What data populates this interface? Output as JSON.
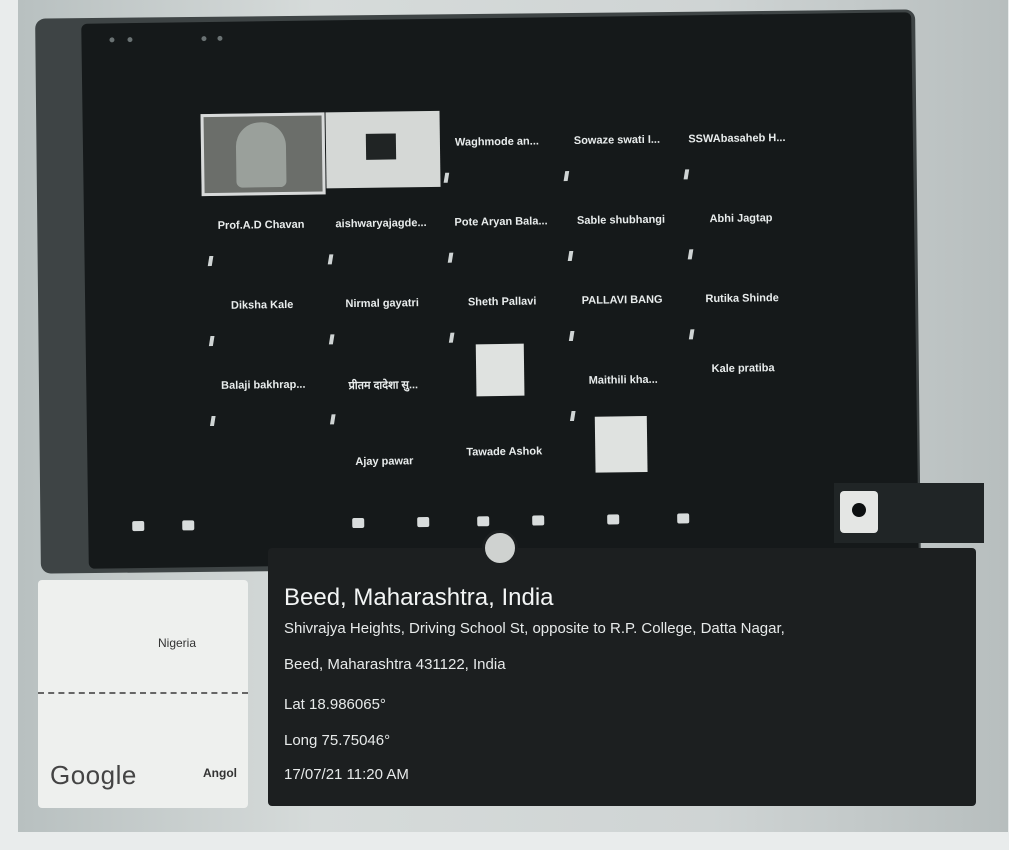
{
  "meeting": {
    "participants": [
      "Waghmode an...",
      "Sowaze swati I...",
      "SSWAbasaheb H...",
      "Prof.A.D Chavan",
      "aishwaryajagde...",
      "Pote Aryan Bala...",
      "Sable shubhangi",
      "Abhi Jagtap",
      "Diksha Kale",
      "Nirmal gayatri",
      "Sheth Pallavi",
      "PALLAVI BANG",
      "Rutika Shinde",
      "Balaji bakhrap...",
      "प्रीतम दादेशा सु...",
      "Maithili kha...",
      "Kale pratiba",
      "Ajay pawar",
      "Tawade Ashok"
    ]
  },
  "location_overlay": {
    "city": "Beed, Maharashtra, India",
    "address_line1": "Shivrajya Heights, Driving School St, opposite to R.P. College, Datta Nagar,",
    "address_line2": "Beed, Maharashtra 431122, India",
    "latitude": "Lat 18.986065°",
    "longitude": "Long 75.75046°",
    "timestamp": "17/07/21 11:20 AM"
  },
  "map": {
    "country_top": "Nigeria",
    "country_bottom": "Angol",
    "brand": "Google"
  },
  "colors": {
    "overlay_bg": "#1c1f20",
    "screen_bg": "#15191a"
  }
}
